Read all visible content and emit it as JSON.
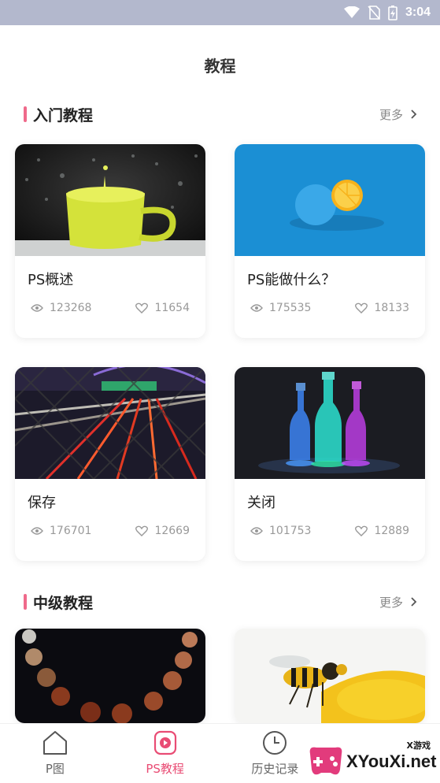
{
  "status_bar": {
    "time": "3:04"
  },
  "page_title": "教程",
  "sections": [
    {
      "title": "入门教程",
      "more_label": "更多",
      "cards": [
        {
          "name": "PS概述",
          "views": "123268",
          "likes": "11654"
        },
        {
          "name": "PS能做什么？",
          "views": "175535",
          "likes": "18133"
        },
        {
          "name": "保存",
          "views": "176701",
          "likes": "12669"
        },
        {
          "name": "关闭",
          "views": "101753",
          "likes": "12889"
        }
      ]
    },
    {
      "title": "中级教程",
      "more_label": "更多"
    }
  ],
  "tabbar": {
    "items": [
      {
        "label": "P图",
        "icon": "home-icon"
      },
      {
        "label": "PS教程",
        "icon": "play-icon",
        "active": true
      },
      {
        "label": "历史记录",
        "icon": "clock-icon"
      }
    ]
  },
  "watermark": {
    "text": "XYouXi.net",
    "small": "X游戏"
  },
  "colors": {
    "accent": "#e94c74",
    "status_bar": "#b3b8cd",
    "section_bar": "#ef6a8b"
  }
}
